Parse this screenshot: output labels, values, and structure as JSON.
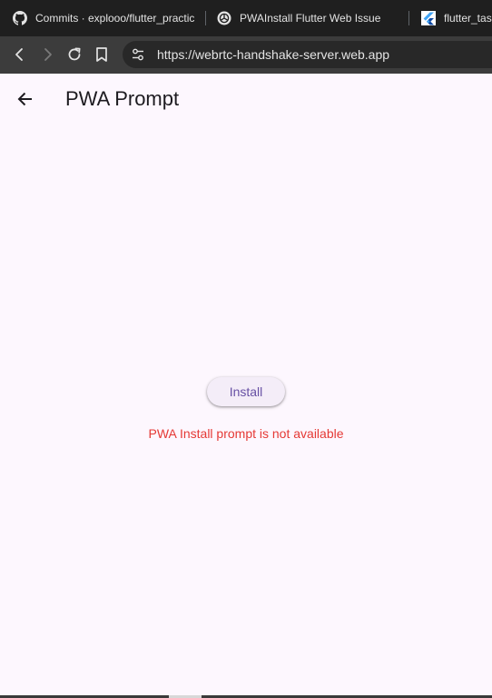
{
  "tabs": [
    {
      "title": "Commits · explooo/flutter_practic",
      "icon": "github-icon"
    },
    {
      "title": "PWAInstall Flutter Web Issue",
      "icon": "chatgpt-icon"
    },
    {
      "title": "flutter_tasl",
      "icon": "flutter-icon"
    }
  ],
  "toolbar": {
    "url": "https://webrtc-handshake-server.web.app"
  },
  "appbar": {
    "title": "PWA Prompt"
  },
  "main": {
    "install_label": "Install",
    "status_message": "PWA Install prompt is not available"
  },
  "colors": {
    "accent": "#6750a4",
    "error": "#e53935",
    "surface": "#fdf7fe"
  }
}
